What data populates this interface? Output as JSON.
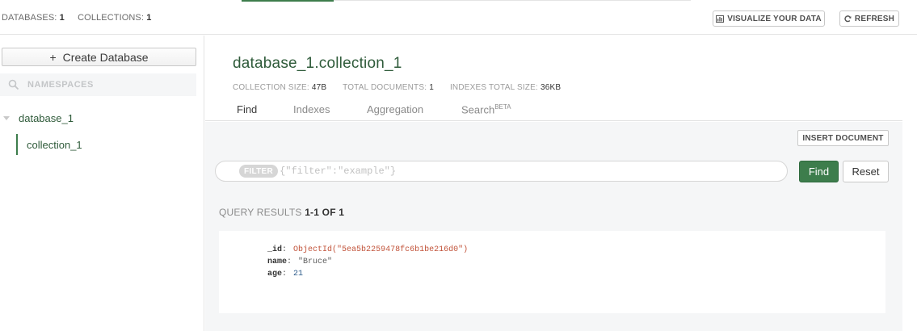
{
  "header": {
    "databases_label": "DATABASES:",
    "databases_count": "1",
    "collections_label": "COLLECTIONS:",
    "collections_count": "1",
    "visualize_label": "VISUALIZE YOUR DATA",
    "refresh_label": "REFRESH"
  },
  "sidebar": {
    "create_db_label": "Create Database",
    "namespace_placeholder": "NAMESPACES",
    "database_name": "database_1",
    "collection_name": "collection_1"
  },
  "collection": {
    "title": "database_1.collection_1",
    "stats": {
      "size_label": "COLLECTION SIZE:",
      "size_value": "47B",
      "docs_label": "TOTAL DOCUMENTS:",
      "docs_value": "1",
      "indexes_label": "INDEXES TOTAL SIZE:",
      "indexes_value": "36KB"
    },
    "tabs": [
      {
        "label": "Find",
        "active": true
      },
      {
        "label": "Indexes",
        "active": false
      },
      {
        "label": "Aggregation",
        "active": false
      },
      {
        "label": "Search",
        "sup": "BETA",
        "active": false
      }
    ]
  },
  "find": {
    "insert_label": "INSERT DOCUMENT",
    "filter_label": "FILTER",
    "filter_placeholder": "{\"filter\":\"example\"}",
    "find_label": "Find",
    "reset_label": "Reset",
    "results_label": "QUERY RESULTS",
    "results_count": "1-1 OF 1"
  },
  "document": {
    "fields": [
      {
        "key": "_id",
        "value": "ObjectId(\"5ea5b2259478fc6b1be216d0\")",
        "kind": "oid"
      },
      {
        "key": "name",
        "value": "\"Bruce\"",
        "kind": "str"
      },
      {
        "key": "age",
        "value": "21",
        "kind": "num"
      }
    ]
  },
  "colors": {
    "accent": "#3d7d4c",
    "brand_text": "#2f5b3a",
    "objectid": "#c2543b"
  },
  "icons": {
    "visualize": "bar-chart-icon",
    "refresh": "refresh-icon",
    "create": "plus-icon",
    "search": "search-icon",
    "caret": "caret-down-icon"
  }
}
